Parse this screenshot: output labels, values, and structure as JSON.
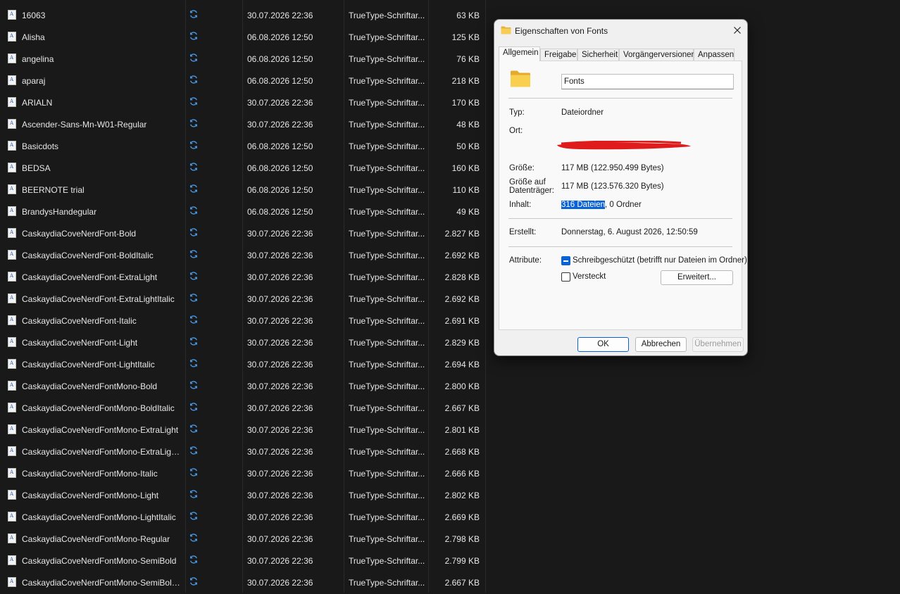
{
  "files": [
    {
      "name": "16063",
      "date": "30.07.2026 22:36",
      "type": "TrueType-Schriftar...",
      "size": "63 KB"
    },
    {
      "name": "Alisha",
      "date": "06.08.2026 12:50",
      "type": "TrueType-Schriftar...",
      "size": "125 KB"
    },
    {
      "name": "angelina",
      "date": "06.08.2026 12:50",
      "type": "TrueType-Schriftar...",
      "size": "76 KB"
    },
    {
      "name": "aparaj",
      "date": "06.08.2026 12:50",
      "type": "TrueType-Schriftar...",
      "size": "218 KB"
    },
    {
      "name": "ARIALN",
      "date": "30.07.2026 22:36",
      "type": "TrueType-Schriftar...",
      "size": "170 KB"
    },
    {
      "name": "Ascender-Sans-Mn-W01-Regular",
      "date": "30.07.2026 22:36",
      "type": "TrueType-Schriftar...",
      "size": "48 KB"
    },
    {
      "name": "Basicdots",
      "date": "06.08.2026 12:50",
      "type": "TrueType-Schriftar...",
      "size": "50 KB"
    },
    {
      "name": "BEDSA",
      "date": "06.08.2026 12:50",
      "type": "TrueType-Schriftar...",
      "size": "160 KB"
    },
    {
      "name": "BEERNOTE trial",
      "date": "06.08.2026 12:50",
      "type": "TrueType-Schriftar...",
      "size": "110 KB"
    },
    {
      "name": "BrandysHandegular",
      "date": "06.08.2026 12:50",
      "type": "TrueType-Schriftar...",
      "size": "49 KB"
    },
    {
      "name": "CaskaydiaCoveNerdFont-Bold",
      "date": "30.07.2026 22:36",
      "type": "TrueType-Schriftar...",
      "size": "2.827 KB"
    },
    {
      "name": "CaskaydiaCoveNerdFont-BoldItalic",
      "date": "30.07.2026 22:36",
      "type": "TrueType-Schriftar...",
      "size": "2.692 KB"
    },
    {
      "name": "CaskaydiaCoveNerdFont-ExtraLight",
      "date": "30.07.2026 22:36",
      "type": "TrueType-Schriftar...",
      "size": "2.828 KB"
    },
    {
      "name": "CaskaydiaCoveNerdFont-ExtraLightItalic",
      "date": "30.07.2026 22:36",
      "type": "TrueType-Schriftar...",
      "size": "2.692 KB"
    },
    {
      "name": "CaskaydiaCoveNerdFont-Italic",
      "date": "30.07.2026 22:36",
      "type": "TrueType-Schriftar...",
      "size": "2.691 KB"
    },
    {
      "name": "CaskaydiaCoveNerdFont-Light",
      "date": "30.07.2026 22:36",
      "type": "TrueType-Schriftar...",
      "size": "2.829 KB"
    },
    {
      "name": "CaskaydiaCoveNerdFont-LightItalic",
      "date": "30.07.2026 22:36",
      "type": "TrueType-Schriftar...",
      "size": "2.694 KB"
    },
    {
      "name": "CaskaydiaCoveNerdFontMono-Bold",
      "date": "30.07.2026 22:36",
      "type": "TrueType-Schriftar...",
      "size": "2.800 KB"
    },
    {
      "name": "CaskaydiaCoveNerdFontMono-BoldItalic",
      "date": "30.07.2026 22:36",
      "type": "TrueType-Schriftar...",
      "size": "2.667 KB"
    },
    {
      "name": "CaskaydiaCoveNerdFontMono-ExtraLight",
      "date": "30.07.2026 22:36",
      "type": "TrueType-Schriftar...",
      "size": "2.801 KB"
    },
    {
      "name": "CaskaydiaCoveNerdFontMono-ExtraLigh...",
      "date": "30.07.2026 22:36",
      "type": "TrueType-Schriftar...",
      "size": "2.668 KB"
    },
    {
      "name": "CaskaydiaCoveNerdFontMono-Italic",
      "date": "30.07.2026 22:36",
      "type": "TrueType-Schriftar...",
      "size": "2.666 KB"
    },
    {
      "name": "CaskaydiaCoveNerdFontMono-Light",
      "date": "30.07.2026 22:36",
      "type": "TrueType-Schriftar...",
      "size": "2.802 KB"
    },
    {
      "name": "CaskaydiaCoveNerdFontMono-LightItalic",
      "date": "30.07.2026 22:36",
      "type": "TrueType-Schriftar...",
      "size": "2.669 KB"
    },
    {
      "name": "CaskaydiaCoveNerdFontMono-Regular",
      "date": "30.07.2026 22:36",
      "type": "TrueType-Schriftar...",
      "size": "2.798 KB"
    },
    {
      "name": "CaskaydiaCoveNerdFontMono-SemiBold",
      "date": "30.07.2026 22:36",
      "type": "TrueType-Schriftar...",
      "size": "2.799 KB"
    },
    {
      "name": "CaskaydiaCoveNerdFontMono-SemiBold...",
      "date": "30.07.2026 22:36",
      "type": "TrueType-Schriftar...",
      "size": "2.667 KB"
    }
  ],
  "icons": {
    "file": "font-file-icon",
    "sync": "sync-icon",
    "folder": "folder-icon",
    "close": "close-icon"
  },
  "colors": {
    "background": "#191919",
    "sync": "#4a9ff0",
    "accent": "#0a63d6",
    "redaction": "#e01b1b"
  },
  "dialog": {
    "title": "Eigenschaften von Fonts",
    "tabs": [
      "Allgemein",
      "Freigabe",
      "Sicherheit",
      "Vorgängerversionen",
      "Anpassen"
    ],
    "folder_name": "Fonts",
    "type_label": "Typ:",
    "type_value": "Dateiordner",
    "location_label": "Ort:",
    "size_label": "Größe:",
    "size_value": "117 MB (122.950.499 Bytes)",
    "disk_size_label_1": "Größe auf",
    "disk_size_label_2": "Datenträger:",
    "disk_size_value": "117 MB (123.576.320 Bytes)",
    "content_label": "Inhalt:",
    "content_files": "316 Dateien",
    "content_folders": ", 0 Ordner",
    "created_label": "Erstellt:",
    "created_value": "Donnerstag, 6. August 2026, 12:50:59",
    "attributes_label": "Attribute:",
    "readonly_label": "Schreibgeschützt (betrifft nur Dateien im Ordner)",
    "hidden_label": "Versteckt",
    "advanced_button": "Erweitert...",
    "ok_button": "OK",
    "cancel_button": "Abbrechen",
    "apply_button": "Übernehmen"
  }
}
